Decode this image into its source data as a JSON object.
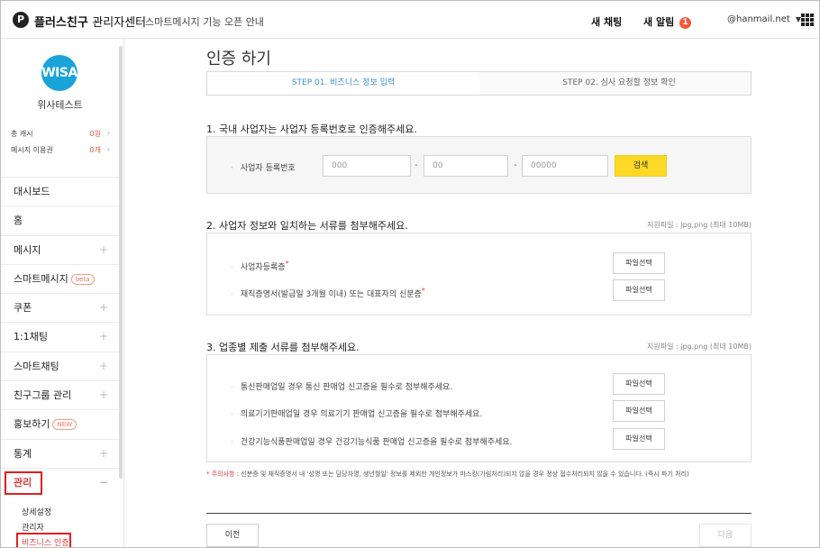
{
  "header": {
    "logo_mark": "P",
    "brand_bold": "플러스친구",
    "brand_light": "관리자센터",
    "notice": "스마트메시지 기능 오픈 안내",
    "new_chat": "새 채팅",
    "new_alarm": "새 알림",
    "alarm_count": "1",
    "account": "@hanmail.net",
    "account_caret": "▼"
  },
  "profile": {
    "logo_text": "WISA",
    "name": "위사테스트",
    "cash_label": "총 캐시",
    "cash_value": "0원",
    "voucher_label": "메시지 이용권",
    "voucher_value": "0개"
  },
  "sidebar": {
    "items": [
      {
        "label": "대시보드",
        "plus": ""
      },
      {
        "label": "홈",
        "plus": ""
      },
      {
        "label": "메시지",
        "plus": "+"
      },
      {
        "label": "스마트메시지",
        "plus": "",
        "badge": "beta"
      },
      {
        "label": "쿠폰",
        "plus": "+"
      },
      {
        "label": "1:1채팅",
        "plus": "+"
      },
      {
        "label": "스마트채팅",
        "plus": "+"
      },
      {
        "label": "친구그룹 관리",
        "plus": "+"
      },
      {
        "label": "홍보하기",
        "plus": "",
        "badge": "NEW"
      },
      {
        "label": "통계",
        "plus": "+"
      },
      {
        "label": "관리",
        "plus": "−"
      }
    ],
    "sub_items": [
      "상세설정",
      "관리자",
      "비즈니스 인증"
    ]
  },
  "main": {
    "title": "인증 하기",
    "step1": "STEP 01. 비즈니스 정보 입력",
    "step2": "STEP 02. 심사 요청할 정보 확인",
    "section1": {
      "title": "1. 국내 사업자는 사업자 등록번호로 인증해주세요.",
      "label": "사업자 등록번호",
      "ph1": "000",
      "ph2": "00",
      "ph3": "00000",
      "dash": "-",
      "search": "검색"
    },
    "section2": {
      "title": "2. 사업자 정보와 일치하는 서류를 첨부해주세요.",
      "note": "지원파일 : jpg,png (최대 10MB)",
      "row1": "사업자등록증",
      "row2": "재직증명서(발급일 3개월 이내) 또는 대표자의 신분증",
      "button": "파일선택"
    },
    "section3": {
      "title": "3. 업종별 제출 서류를 첨부해주세요.",
      "note": "지원파일 : jpg,png (최대 10MB)",
      "row1": "통신판매업일 경우 통신 판매업 신고증을 필수로 첨부해주세요.",
      "row2": "의료기기판매업일 경우 의료기기 판매업 신고증을 필수로 첨부해주세요.",
      "row3": "건강기능식품판매업일 경우 건강기능식품 판매업 신고증을 필수로 첨부해주세요.",
      "button": "파일선택"
    },
    "privacy_em": "* 주의사항",
    "privacy": " : 신분증 및 재직증명서 내 '성명 또는 담당자명, 생년월일' 정보를 제외한 개인정보가 마스킹(가림처리)되지 않을 경우 정상 접수처리되지 않을 수 있습니다. (즉시 파기 처리)",
    "prev": "이전",
    "next": "다음"
  },
  "colors": {
    "accent_blue": "#3a8fd6",
    "search_yellow": "#fcd926",
    "alert_red": "#e03c3c",
    "brand_avatar": "#1aa3d9"
  }
}
